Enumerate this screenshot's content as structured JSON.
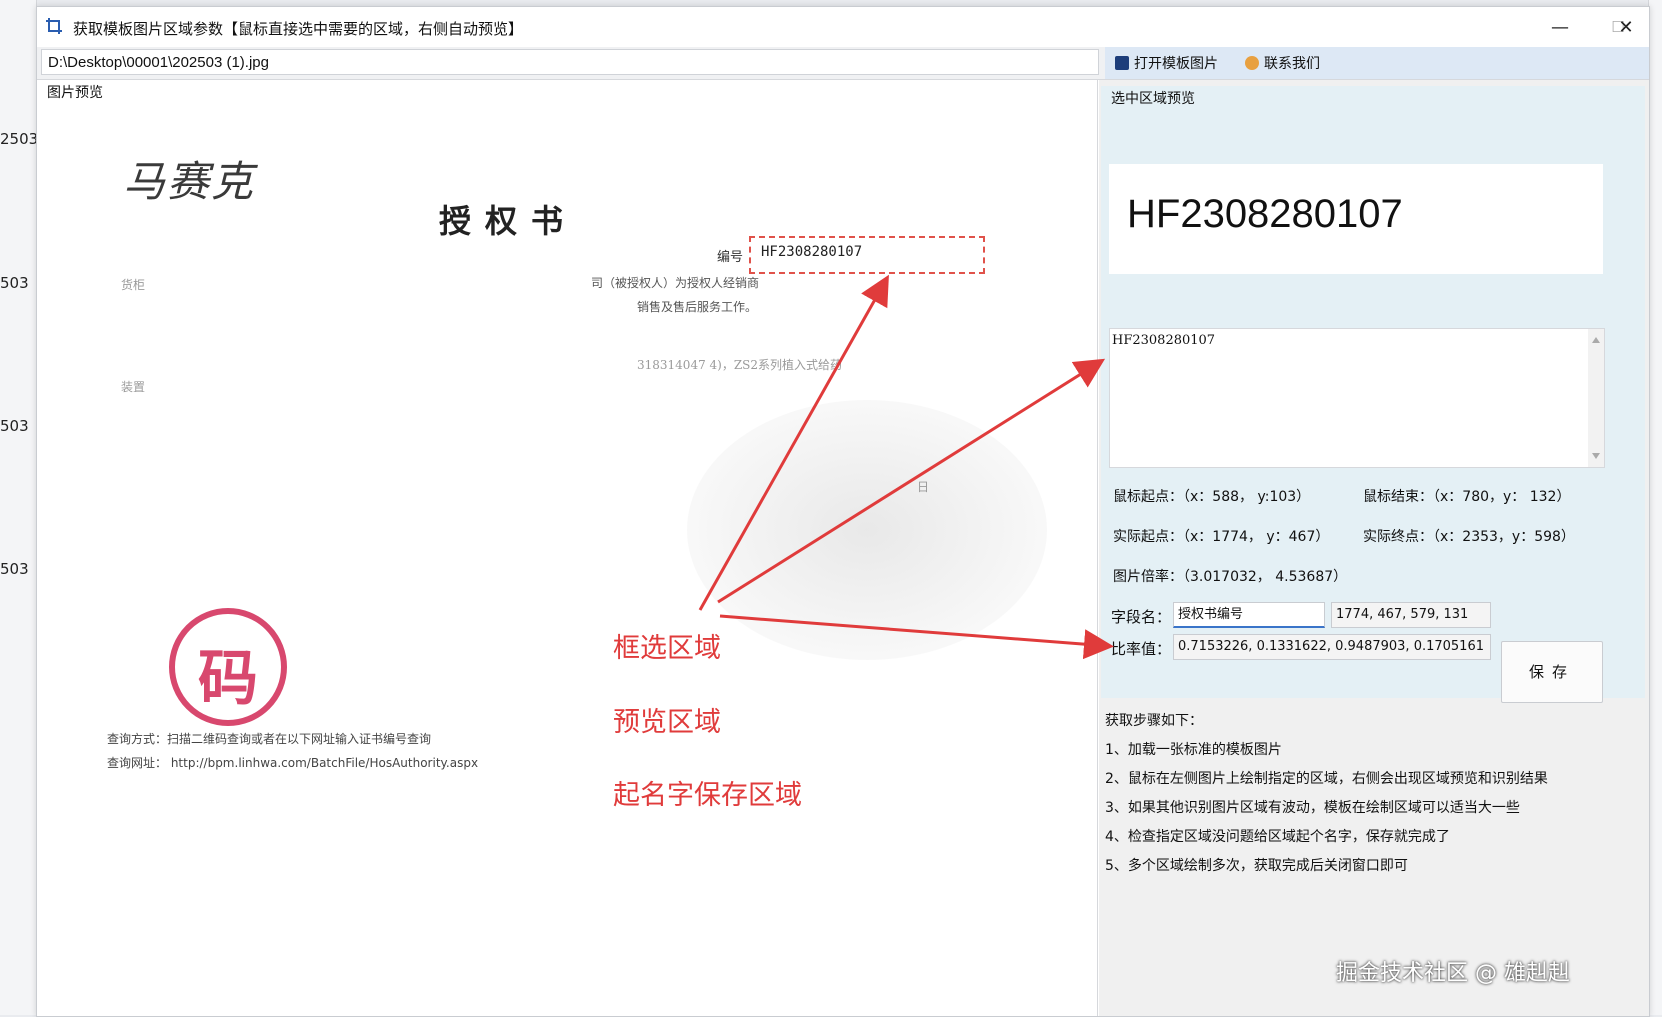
{
  "background_app": {
    "row_labels": [
      "2503",
      "503",
      "503",
      "503"
    ]
  },
  "window": {
    "title": "获取模板图片区域参数【鼠标直接选中需要的区域，右侧自动预览】",
    "controls": {
      "minimize": "—",
      "maximize": "☐",
      "close": "✕"
    }
  },
  "pathbar": {
    "path": "D:\\Desktop\\00001\\202503 (1).jpg",
    "open_template_label": "打开模板图片",
    "contact_label": "联系我们"
  },
  "left_panel": {
    "group_title": "图片预览",
    "document": {
      "logo_text": "马赛克",
      "title": "授权书",
      "number_label": "编号",
      "number_value": "HF2308280107",
      "line_1": "司（被授权人）为授权人经销商",
      "line_1_prefix": "货柜",
      "line_2": "销售及售后服务工作。",
      "line_3": "318314047 4)，ZS2系列植入式给药",
      "line_4_prefix": "装置",
      "line_5": "日",
      "stamp_char": "码",
      "query_method": "查询方式：扫描二维码查询或者在以下网址输入证书编号查询",
      "query_url": "查询网址： http://bpm.linhwa.com/BatchFile/HosAuthority.aspx"
    }
  },
  "annotations": {
    "select_area": "框选区域",
    "preview_area": "预览区域",
    "name_save_area": "起名字保存区域"
  },
  "right_panel": {
    "group_title": "选中区域预览",
    "preview_text": "HF2308280107",
    "ocr_text": "HF2308280107",
    "mouse_start": "鼠标起点：（x：588， y:103）",
    "mouse_end": "鼠标结束：（x：780，y： 132）",
    "actual_start": "实际起点：（x：1774， y：467）",
    "actual_end": "实际终点：（x：2353，y：598）",
    "scale": "图片倍率：（3.017032， 4.53687）",
    "field_name_label": "字段名：",
    "field_name_value": "授权书编号",
    "field_coords_value": "1774, 467, 579, 131",
    "ratio_label": "比率值：",
    "ratio_value": "0.7153226, 0.1331622, 0.9487903, 0.1705161",
    "save_label": "保存",
    "steps_title": "获取步骤如下：",
    "steps": [
      "1、加载一张标准的模板图片",
      "2、鼠标在左侧图片上绘制指定的区域，右侧会出现区域预览和识别结果",
      "3、如果其他识别图片区域有波动，模板在绘制区域可以适当大一些",
      "4、检查指定区域没问题给区域起个名字，保存就完成了",
      "5、多个区域绘制多次，获取完成后关闭窗口即可"
    ]
  },
  "footer": {
    "watermark": "掘金技术社区 @ 雄赳赳"
  },
  "colors": {
    "annotation_red": "#e03b3b",
    "select_box_border": "#e0524a",
    "stamp": "#d8486e",
    "toolbar_right_bg": "#dde8f5"
  }
}
